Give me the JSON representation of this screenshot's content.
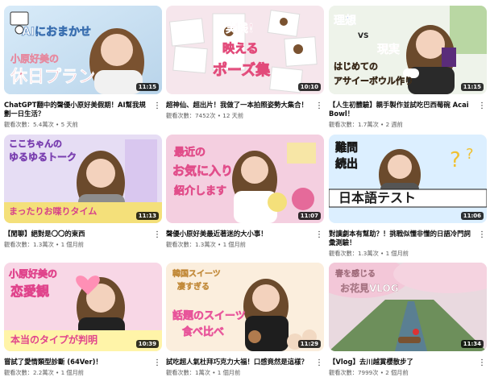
{
  "videos": [
    {
      "title": "ChatGPT翻中的聲優小原好美假期！AI幫我規劃一日生活？",
      "views_label": "觀看次數：",
      "views": "5.4萬次",
      "age": "5 天前",
      "duration": "11:15",
      "thumb_text": [
        "AIにおまかせ",
        "小原好美の",
        "休日プラン"
      ],
      "colors": {
        "bg": "#cfe3f3",
        "accent": "#e58aa0"
      }
    },
    {
      "title": "超神仙、超出片！我做了一本拍照姿勢大集合！",
      "views_label": "觀看次數：",
      "views": "7452次",
      "age": "12 天前",
      "duration": "10:10",
      "thumb_text": [
        "実践！",
        "映える",
        "ポーズ集"
      ],
      "colors": {
        "bg": "#f6e6ec",
        "accent": "#e24a7a"
      }
    },
    {
      "title": "【人生初體驗】親手製作並試吃巴西莓碗 Acai Bowl！",
      "views_label": "觀看次數：",
      "views": "1.7萬次",
      "age": "2 週前",
      "duration": "11:15",
      "thumb_text": [
        "理想",
        "VS",
        "現実",
        "はじめての",
        "アサイーボウル作り"
      ],
      "colors": {
        "bg": "#eef3ea",
        "accent": "#3f6fd8"
      }
    },
    {
      "title": "【閒聊】絕對是〇〇的東西",
      "views_label": "觀看次數：",
      "views": "1.3萬次",
      "age": "1 個月前",
      "duration": "11:13",
      "thumb_text": [
        "ここちゃんの",
        "ゆるゆるトーク",
        "まったりお喋りタイム"
      ],
      "colors": {
        "bg": "#e6ddf4",
        "accent": "#d6418a"
      }
    },
    {
      "title": "聲優小原好美最近著迷的大小事！",
      "views_label": "觀看次數：",
      "views": "1.3萬次",
      "age": "1 個月前",
      "duration": "11:07",
      "thumb_text": [
        "最近の",
        "お気に入り",
        "紹介します"
      ],
      "colors": {
        "bg": "#f4cfe0",
        "accent": "#e14d8a"
      }
    },
    {
      "title": "對讀劇本有幫助？！挑戰似懂非懂的日語冷門詞彙測驗！",
      "views_label": "觀看次數：",
      "views": "1.3萬次",
      "age": "1 個月前",
      "duration": "11:06",
      "thumb_text": [
        "難問",
        "続出",
        "日本語テスト"
      ],
      "colors": {
        "bg": "#dcefff",
        "accent": "#1b1b1b"
      }
    },
    {
      "title": "嘗試了愛情類型診斷 (64Ver)！",
      "views_label": "觀看次數：",
      "views": "2.2萬次",
      "age": "1 個月前",
      "duration": "10:39",
      "thumb_text": [
        "小原好美の",
        "恋愛観",
        "本当のタイプが判明"
      ],
      "colors": {
        "bg": "#f8d7e6",
        "accent": "#e0448c"
      }
    },
    {
      "title": "試吃超人氣杜拜巧克力大福！口感竟然是這樣？",
      "views_label": "觀看次數：",
      "views": "1萬次",
      "age": "1 個月前",
      "duration": "11:29",
      "thumb_text": [
        "韓国スイーツ",
        "凄すぎる",
        "話題のスイーツ",
        "食べ比べ"
      ],
      "colors": {
        "bg": "#fbeedd",
        "accent": "#e8559a"
      }
    },
    {
      "title": "【Vlog】去川越賞櫻散步了",
      "views_label": "觀看次數：",
      "views": "7999次",
      "age": "2 個月前",
      "duration": "11:34",
      "thumb_text": [
        "春を感じる",
        "お花見VLOG"
      ],
      "colors": {
        "bg": "#e9d9df",
        "accent": "#ffffff"
      }
    }
  ]
}
